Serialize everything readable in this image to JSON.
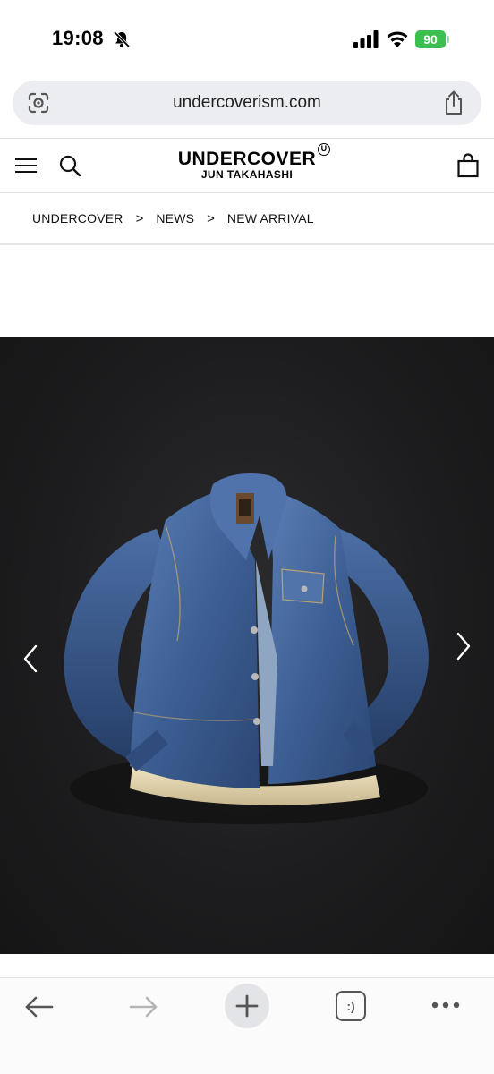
{
  "status_bar": {
    "time": "19:08",
    "battery_level": "90",
    "icons": [
      "bell-muted-icon",
      "signal-icon",
      "wifi-icon",
      "battery-charging-icon"
    ]
  },
  "browser": {
    "url": "undercoverism.com",
    "icons": [
      "lens-icon",
      "share-icon"
    ]
  },
  "site_header": {
    "logo_main": "UNDERCOVER",
    "logo_badge": "U",
    "logo_sub": "JUN TAKAHASHI",
    "icons": [
      "menu-icon",
      "search-icon",
      "shopping-bag-icon"
    ]
  },
  "breadcrumb": {
    "items": [
      "UNDERCOVER",
      "NEWS",
      "NEW ARRIVAL"
    ],
    "separator": ">"
  },
  "hero": {
    "image_subject": "denim jacket",
    "icons": [
      "chevron-left-icon",
      "chevron-right-icon"
    ]
  },
  "toolbar": {
    "tabs_label": ":)",
    "icons": [
      "back-arrow-icon",
      "forward-arrow-icon",
      "plus-icon",
      "more-icon"
    ]
  },
  "colors": {
    "battery_green": "#3bbf4f",
    "url_bar_bg": "#ecedf0",
    "hero_bg": "#1d1d1f",
    "denim": "#3d5f94"
  }
}
